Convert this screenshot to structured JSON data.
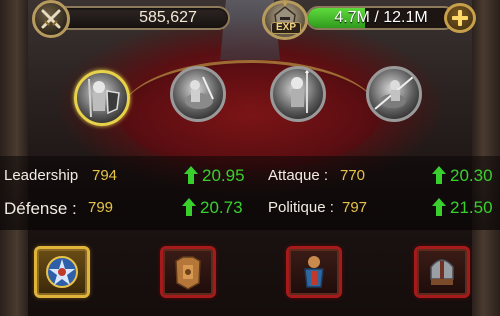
{
  "topbar": {
    "power": "585,627",
    "exp_label": "EXP",
    "exp_text": "4.7M / 12.1M",
    "exp_progress": 0.39,
    "icons": {
      "power": "crossed-swords-icon",
      "hero": "hero-portrait-icon",
      "add": "plus-icon"
    }
  },
  "generals": [
    {
      "name": "general-1",
      "selected": true
    },
    {
      "name": "general-2",
      "selected": false
    },
    {
      "name": "general-3",
      "selected": false
    },
    {
      "name": "general-4",
      "selected": false
    }
  ],
  "stats": {
    "leadership": {
      "label": "Leadership",
      "value": "794",
      "bonus": "20.95"
    },
    "attack": {
      "label": "Attaque :",
      "value": "770",
      "bonus": "20.30"
    },
    "defense": {
      "label": "Défense :",
      "value": "799",
      "bonus": "20.73"
    },
    "politics": {
      "label": "Politique :",
      "value": "797",
      "bonus": "21.50"
    }
  },
  "equipment": [
    {
      "slot": "slot-1",
      "icon": "blue-star-emblem-icon",
      "frame": "gold"
    },
    {
      "slot": "slot-2",
      "icon": "bronze-armor-icon",
      "frame": "red"
    },
    {
      "slot": "slot-3",
      "icon": "warrior-idol-icon",
      "frame": "red"
    },
    {
      "slot": "slot-4",
      "icon": "steel-helmet-icon",
      "frame": "red"
    }
  ],
  "colors": {
    "stat_value": "#e6c44a",
    "bonus": "#39d02e",
    "exp_bar": "#4fc22e",
    "selected_ring": "#e8d24a",
    "slot_red": "#a51a1a",
    "slot_gold": "#e0b43a"
  }
}
